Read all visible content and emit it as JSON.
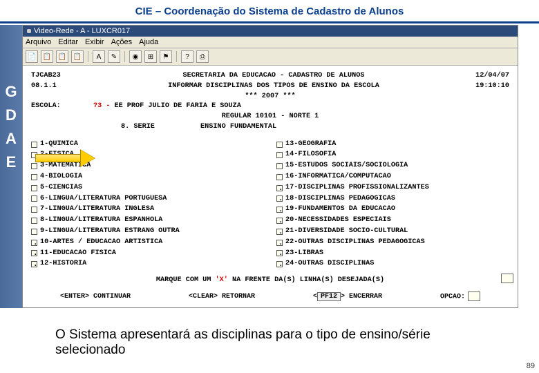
{
  "slide": {
    "title": "CIE – Coordenação do Sistema de Cadastro de Alunos",
    "caption": "O Sistema apresentará as disciplinas para o tipo de ensino/série selecionado",
    "page_number": "89"
  },
  "sidebar": {
    "letters": [
      "G",
      "D",
      "A",
      "E"
    ]
  },
  "window": {
    "title": "Video-Rede - A - LUXCR017",
    "menu": [
      "Arquivo",
      "Editar",
      "Exibir",
      "Ações",
      "Ajuda"
    ],
    "tool_icons": [
      "doc",
      "copy",
      "paste",
      "paste2",
      "|",
      "A",
      "mark",
      "|",
      "stamp",
      "tool",
      "flag",
      "|",
      "help",
      "prn"
    ]
  },
  "terminal": {
    "row1": {
      "left": "TJCAB23",
      "center": "SECRETARIA DA EDUCACAO - CADASTRO DE ALUNOS",
      "right": "12/04/07"
    },
    "row2": {
      "left": "08.1.1",
      "center": "INFORMAR DISCIPLINAS DOS TIPOS DE ENSINO DA ESCOLA",
      "right": "19:10:10"
    },
    "year_line": "***   2007   ***",
    "escola": {
      "label": "ESCOLA:",
      "code": "?3 -",
      "name": "EE PROF JULIO DE FARIA E SOUZA"
    },
    "sub1": "REGULAR      10101 - NORTE 1",
    "serie": {
      "num": "8. SERIE",
      "tipo": "ENSINO FUNDAMENTAL"
    },
    "disc_left": [
      {
        "n": "1",
        "t": "QUIMICA"
      },
      {
        "n": "2",
        "t": "FISICA"
      },
      {
        "n": "3",
        "t": "MATEMATICA"
      },
      {
        "n": "4",
        "t": "BIOLOGIA"
      },
      {
        "n": "5",
        "t": "CIENCIAS"
      },
      {
        "n": "6",
        "t": "LINGUA/LITERATURA PORTUGUESA"
      },
      {
        "n": "7",
        "t": "LINGUA/LITERATURA INGLESA"
      },
      {
        "n": "8",
        "t": "LINGUA/LITERATURA ESPANHOLA"
      },
      {
        "n": "9",
        "t": "LINGUA/LITERATURA ESTRANG OUTRA"
      },
      {
        "n": "10",
        "t": "ARTES / EDUCACAO ARTISTICA"
      },
      {
        "n": "11",
        "t": "EDUCACAO FISICA"
      },
      {
        "n": "12",
        "t": "HISTORIA"
      }
    ],
    "disc_right": [
      {
        "n": "13",
        "t": "GEOGRAFIA"
      },
      {
        "n": "14",
        "t": "FILOSOFIA"
      },
      {
        "n": "15",
        "t": "ESTUDOS SOCIAIS/SOCIOLOGIA"
      },
      {
        "n": "16",
        "t": "INFORMATICA/COMPUTACAO"
      },
      {
        "n": "17",
        "t": "DISCIPLINAS PROFISSIONALIZANTES"
      },
      {
        "n": "18",
        "t": "DISCIPLINAS PEDAGOGICAS"
      },
      {
        "n": "19",
        "t": "FUNDAMENTOS DA EDUCACAO"
      },
      {
        "n": "20",
        "t": "NECESSIDADES ESPECIAIS"
      },
      {
        "n": "21",
        "t": "DIVERSIDADE SOCIO-CULTURAL"
      },
      {
        "n": "22",
        "t": "OUTRAS DISCIPLINAS PEDAGOGICAS"
      },
      {
        "n": "23",
        "t": "LIBRAS"
      },
      {
        "n": "24",
        "t": "OUTRAS DISCIPLINAS"
      }
    ],
    "marque_pre": "MARQUE COM UM  ",
    "marque_x": "'X'",
    "marque_post": "  NA FRENTE DA(S) LINHA(S) DESEJADA(S)",
    "footer": {
      "enter": "<ENTER> CONTINUAR",
      "clear": "<CLEAR> RETORNAR",
      "pf12_btn": "PF12",
      "pf12_txt": "> ENCERRAR",
      "opcao": "OPCAO:"
    }
  }
}
